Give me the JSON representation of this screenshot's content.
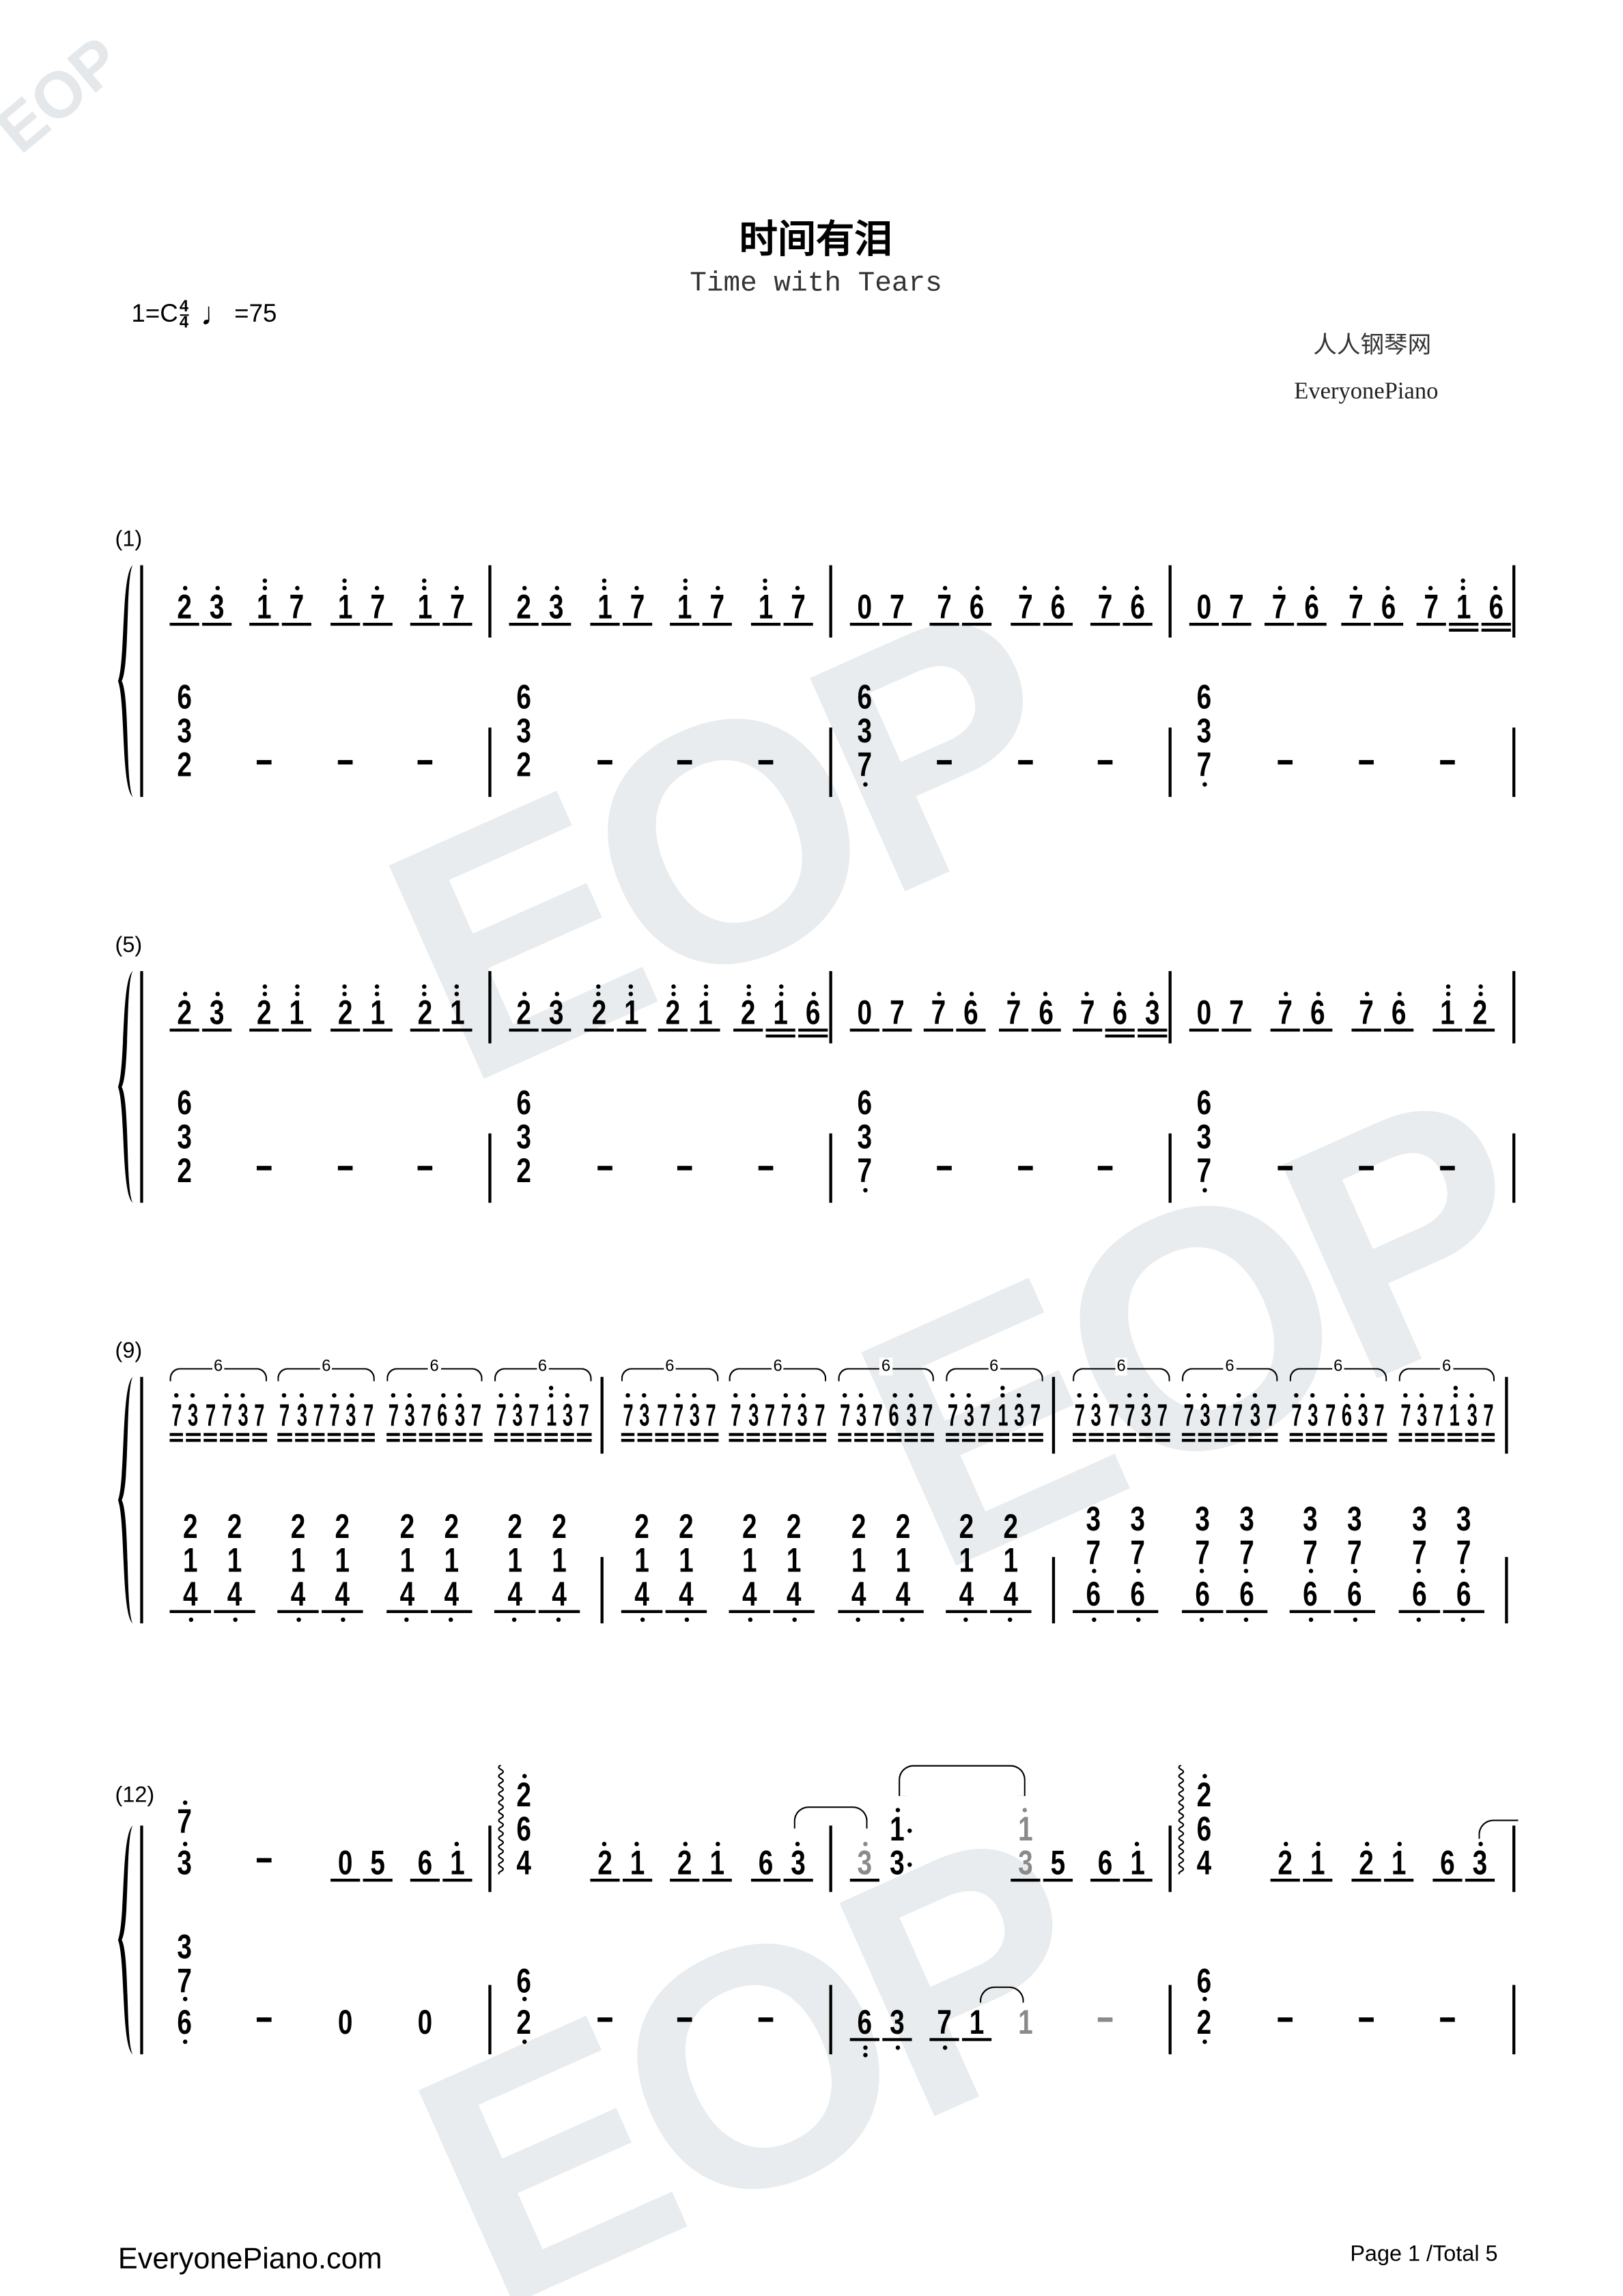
{
  "header": {
    "title": "时间有泪",
    "subtitle": "Time with Tears",
    "key": "1=C",
    "time_top": "4",
    "time_bottom": "4",
    "tempo_icon": "quarter-note-icon",
    "tempo": "=75",
    "site_cn": "人人钢琴网",
    "site_en": "EveryonePiano"
  },
  "watermark": "EOP",
  "colors": {
    "ink": "#000000",
    "gray_note": "#8a8a8a",
    "watermark": "#e8ecee"
  },
  "systems": [
    {
      "number": "(1)",
      "measures": [
        {
          "treble": [
            {
              "n": "2' 3'",
              "u": 1
            },
            {
              "n": "1'' 7'",
              "u": 1
            },
            {
              "n": "1'' 7'",
              "u": 1
            },
            {
              "n": "1'' 7'",
              "u": 1
            }
          ],
          "bass": [
            {
              "n": "6/3/2"
            },
            {
              "n": "-"
            },
            {
              "n": "-"
            },
            {
              "n": "-"
            }
          ]
        },
        {
          "treble": [
            {
              "n": "2' 3'",
              "u": 1
            },
            {
              "n": "1'' 7'",
              "u": 1
            },
            {
              "n": "1'' 7'",
              "u": 1
            },
            {
              "n": "1'' 7'",
              "u": 1
            }
          ],
          "bass": [
            {
              "n": "6/3/2"
            },
            {
              "n": "-"
            },
            {
              "n": "-"
            },
            {
              "n": "-"
            }
          ]
        },
        {
          "treble": [
            {
              "n": "0 7",
              "u": 1
            },
            {
              "n": "7' 6'",
              "u": 1
            },
            {
              "n": "7' 6'",
              "u": 1
            },
            {
              "n": "7' 6'",
              "u": 1
            }
          ],
          "bass": [
            {
              "n": "6/3/7,"
            },
            {
              "n": "-"
            },
            {
              "n": "-"
            },
            {
              "n": "-"
            }
          ]
        },
        {
          "treble": [
            {
              "n": "0 7",
              "u": 1
            },
            {
              "n": "7' 6'",
              "u": 1
            },
            {
              "n": "7' 6'",
              "u": 1
            },
            {
              "n": "7' 1'' 6'",
              "u": [
                1,
                2,
                2
              ]
            }
          ],
          "bass": [
            {
              "n": "6/3/7,"
            },
            {
              "n": "-"
            },
            {
              "n": "-"
            },
            {
              "n": "-"
            }
          ]
        }
      ]
    },
    {
      "number": "(5)",
      "measures": [
        {
          "treble": [
            {
              "n": "2' 3'",
              "u": 1
            },
            {
              "n": "2'' 1''",
              "u": 1
            },
            {
              "n": "2'' 1''",
              "u": 1
            },
            {
              "n": "2'' 1''",
              "u": 1
            }
          ],
          "bass": [
            {
              "n": "6/3/2"
            },
            {
              "n": "-"
            },
            {
              "n": "-"
            },
            {
              "n": "-"
            }
          ]
        },
        {
          "treble": [
            {
              "n": "2' 3'",
              "u": 1
            },
            {
              "n": "2'' 1''",
              "u": 1
            },
            {
              "n": "2'' 1''",
              "u": 1
            },
            {
              "n": "2'' 1'' 6'",
              "u": [
                1,
                2,
                2
              ]
            }
          ],
          "bass": [
            {
              "n": "6/3/2"
            },
            {
              "n": "-"
            },
            {
              "n": "-"
            },
            {
              "n": "-"
            }
          ]
        },
        {
          "treble": [
            {
              "n": "0 7",
              "u": 1
            },
            {
              "n": "7' 6'",
              "u": 1
            },
            {
              "n": "7' 6'",
              "u": 1
            },
            {
              "n": "7' 6' 3'",
              "u": [
                1,
                2,
                2
              ]
            }
          ],
          "bass": [
            {
              "n": "6/3/7,"
            },
            {
              "n": "-"
            },
            {
              "n": "-"
            },
            {
              "n": "-"
            }
          ]
        },
        {
          "treble": [
            {
              "n": "0 7",
              "u": 1
            },
            {
              "n": "7' 6'",
              "u": 1
            },
            {
              "n": "7' 6'",
              "u": 1
            },
            {
              "n": "1'' 2''",
              "u": 1
            }
          ],
          "bass": [
            {
              "n": "6/3/7,"
            },
            {
              "n": "-"
            },
            {
              "n": "-"
            },
            {
              "n": "-"
            }
          ]
        }
      ]
    },
    {
      "number": "(9)",
      "measures": [
        {
          "treble": [
            {
              "n": "7' 3' 7 7' 3' 7",
              "u": 2,
              "tup": "6"
            },
            {
              "n": "7' 3' 7 7' 3' 7",
              "u": 2,
              "tup": "6"
            },
            {
              "n": "7' 3' 7 6' 3' 7",
              "u": 2,
              "tup": "6"
            },
            {
              "n": "7' 3' 7 1'' 3' 7",
              "u": 2,
              "tup": "6"
            }
          ],
          "bass": [
            {
              "n": "2/1/4, 2/1/4,",
              "u": 1
            },
            {
              "n": "2/1/4, 2/1/4,",
              "u": 1
            },
            {
              "n": "2/1/4, 2/1/4,",
              "u": 1
            },
            {
              "n": "2/1/4, 2/1/4,",
              "u": 1
            }
          ]
        },
        {
          "treble": [
            {
              "n": "7' 3' 7 7' 3' 7",
              "u": 2,
              "tup": "6"
            },
            {
              "n": "7' 3' 7 7' 3' 7",
              "u": 2,
              "tup": "6"
            },
            {
              "n": "7' 3' 7 6' 3' 7",
              "u": 2,
              "tup": "6"
            },
            {
              "n": "7' 3' 7 1'' 3' 7",
              "u": 2,
              "tup": "6"
            }
          ],
          "bass": [
            {
              "n": "2/1/4, 2/1/4,",
              "u": 1
            },
            {
              "n": "2/1/4, 2/1/4,",
              "u": 1
            },
            {
              "n": "2/1/4, 2/1/4,",
              "u": 1
            },
            {
              "n": "2/1/4, 2/1/4,",
              "u": 1
            }
          ]
        },
        {
          "treble": [
            {
              "n": "7' 3' 7 7' 3' 7",
              "u": 2,
              "tup": "6"
            },
            {
              "n": "7' 3' 7 7' 3' 7",
              "u": 2,
              "tup": "6"
            },
            {
              "n": "7' 3' 7 6' 3' 7",
              "u": 2,
              "tup": "6"
            },
            {
              "n": "7' 3' 7 1'' 3' 7",
              "u": 2,
              "tup": "6"
            }
          ],
          "bass": [
            {
              "n": "3/7,/6, 3/7,/6,",
              "u": 1
            },
            {
              "n": "3/7,/6, 3/7,/6,",
              "u": 1
            },
            {
              "n": "3/7,/6, 3/7,/6,",
              "u": 1
            },
            {
              "n": "3/7,/6, 3/7,/6,",
              "u": 1
            }
          ]
        }
      ]
    },
    {
      "number": "(12)",
      "measures": [
        {
          "treble": [
            {
              "n": "7'/3'"
            },
            {
              "n": "-"
            },
            {
              "n": "0 5",
              "u": 1
            },
            {
              "n": "6 1'",
              "u": 1
            }
          ],
          "bass": [
            {
              "n": "3/7,/6,"
            },
            {
              "n": "-"
            },
            {
              "n": "0"
            },
            {
              "n": "0"
            }
          ]
        },
        {
          "treble": [
            {
              "n": "2'/6/4",
              "arp": true
            },
            {
              "n": "2' 1'",
              "u": 1
            },
            {
              "n": "2' 1'",
              "u": 1
            },
            {
              "n": "6 3'",
              "u": 1
            }
          ],
          "bass": [
            {
              "n": "6,/2,"
            },
            {
              "n": "-"
            },
            {
              "n": "-"
            },
            {
              "n": "-"
            }
          ]
        },
        {
          "treble": [
            {
              "n": "3'g 1'./3.",
              "u": [
                1,
                0
              ]
            },
            {
              "n": ""
            },
            {
              "n": "1'g/3g 5",
              "u": 1
            },
            {
              "n": "6 1'",
              "u": 1
            }
          ],
          "bass": [
            {
              "n": "6,, 3,",
              "u": 1
            },
            {
              "n": "7, 1",
              "u": 1
            },
            {
              "n": "1g"
            },
            {
              "n": "-g"
            }
          ]
        },
        {
          "treble": [
            {
              "n": "2'/6/4",
              "arp": true
            },
            {
              "n": "2' 1'",
              "u": 1
            },
            {
              "n": "2' 1'",
              "u": 1
            },
            {
              "n": "6 3'",
              "u": 1
            }
          ],
          "bass": [
            {
              "n": "6,/2,"
            },
            {
              "n": "-"
            },
            {
              "n": "-"
            },
            {
              "n": "-"
            }
          ]
        }
      ]
    }
  ],
  "footer": {
    "site": "EveryonePiano.com",
    "page": "Page 1 /Total 5"
  }
}
